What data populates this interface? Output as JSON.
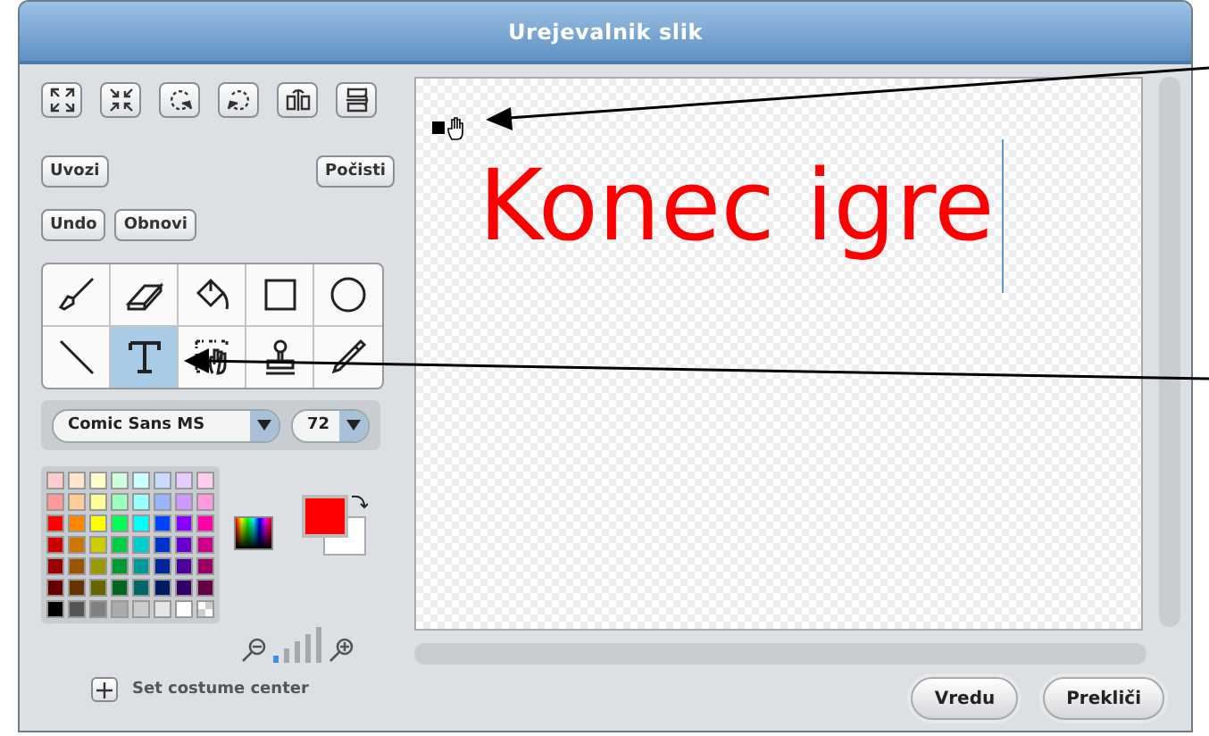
{
  "window": {
    "title": "Urejevalnik slik"
  },
  "transform_tools": [
    {
      "kind": "grow"
    },
    {
      "kind": "shrink"
    },
    {
      "kind": "rotate-left"
    },
    {
      "kind": "rotate-right"
    },
    {
      "kind": "flip-horizontal"
    },
    {
      "kind": "flip-vertical"
    }
  ],
  "buttons_row_1": [
    "Uvozi",
    "Počisti"
  ],
  "buttons_row_2": [
    "Undo",
    "Obnovi"
  ],
  "paint_tools": [
    {
      "kind": "brush",
      "selected": false
    },
    {
      "kind": "eraser",
      "selected": false
    },
    {
      "kind": "fill",
      "selected": false
    },
    {
      "kind": "rectangle",
      "selected": false
    },
    {
      "kind": "ellipse",
      "selected": false
    },
    {
      "kind": "line",
      "selected": false
    },
    {
      "kind": "text",
      "selected": true
    },
    {
      "kind": "select",
      "selected": false
    },
    {
      "kind": "stamp",
      "selected": false
    },
    {
      "kind": "eyedropper",
      "selected": false
    }
  ],
  "font": {
    "family": "Comic Sans MS",
    "size": "72"
  },
  "palette": [
    {
      "color": "#ffcccc"
    },
    {
      "color": "#ffe5cc"
    },
    {
      "color": "#ffffcc"
    },
    {
      "color": "#ccffdd"
    },
    {
      "color": "#ccffff"
    },
    {
      "color": "#ccd9ff"
    },
    {
      "color": "#e5ccff"
    },
    {
      "color": "#ffccee"
    },
    {
      "color": "#ff9999"
    },
    {
      "color": "#ffcc99"
    },
    {
      "color": "#ffff99"
    },
    {
      "color": "#99ffbb"
    },
    {
      "color": "#99ffff"
    },
    {
      "color": "#99b3ff"
    },
    {
      "color": "#cc99ff"
    },
    {
      "color": "#ff99dd"
    },
    {
      "color": "#ff0000"
    },
    {
      "color": "#ff8800"
    },
    {
      "color": "#ffff00"
    },
    {
      "color": "#00ff55"
    },
    {
      "color": "#00ffff"
    },
    {
      "color": "#0044ff"
    },
    {
      "color": "#8800ff"
    },
    {
      "color": "#ff00aa"
    },
    {
      "color": "#cc0000"
    },
    {
      "color": "#cc7700"
    },
    {
      "color": "#cccc00"
    },
    {
      "color": "#00cc44"
    },
    {
      "color": "#00cccc"
    },
    {
      "color": "#0033cc"
    },
    {
      "color": "#6600cc"
    },
    {
      "color": "#cc0088"
    },
    {
      "color": "#990000"
    },
    {
      "color": "#995500"
    },
    {
      "color": "#999900"
    },
    {
      "color": "#009933"
    },
    {
      "color": "#009999"
    },
    {
      "color": "#002699"
    },
    {
      "color": "#4d0099"
    },
    {
      "color": "#990066"
    },
    {
      "color": "#660000"
    },
    {
      "color": "#663300"
    },
    {
      "color": "#666600"
    },
    {
      "color": "#006622"
    },
    {
      "color": "#006666"
    },
    {
      "color": "#001a66"
    },
    {
      "color": "#330066"
    },
    {
      "color": "#660044"
    },
    {
      "color": "#000000"
    },
    {
      "color": "#555555"
    },
    {
      "color": "#808080"
    },
    {
      "color": "#aaaaaa"
    },
    {
      "color": "#cccccc"
    },
    {
      "color": "#e6e6e6"
    },
    {
      "color": "#ffffff"
    }
  ],
  "transparent_swatch": true,
  "current_colors": [
    {
      "kind": "background",
      "color": "#ffffff"
    },
    {
      "kind": "foreground",
      "color": "#ff0000"
    }
  ],
  "zoom": {
    "level": 0.2
  },
  "set_center_label": "Set costume center",
  "canvas": {
    "text": "Konec igre",
    "cursor": true
  },
  "dialog_buttons": [
    "Vredu",
    "Prekliči"
  ]
}
